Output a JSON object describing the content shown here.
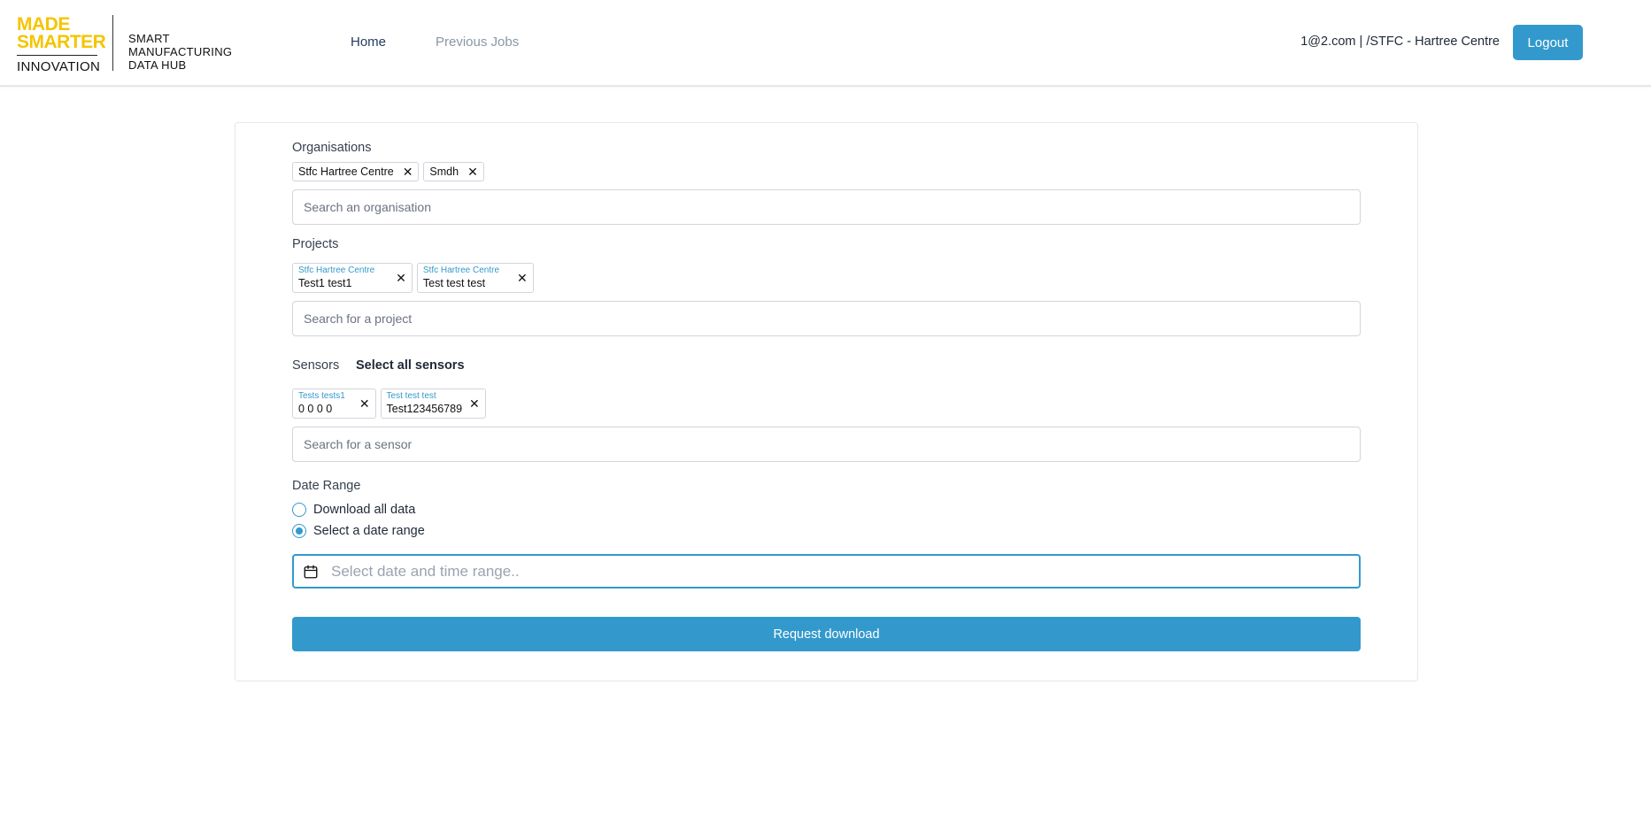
{
  "logo": {
    "line1": "MADE",
    "line2": "SMARTER",
    "line3": "INNOVATION",
    "brand_color": "#f5c400"
  },
  "hub_title": [
    "SMART",
    "MANUFACTURING",
    "DATA HUB"
  ],
  "nav": {
    "home": "Home",
    "previous_jobs": "Previous Jobs"
  },
  "user": {
    "info": "1@2.com | /STFC - Hartree Centre",
    "logout_label": "Logout"
  },
  "form": {
    "organisations": {
      "label": "Organisations",
      "chips": [
        "Stfc Hartree Centre",
        "Smdh"
      ],
      "placeholder": "Search an organisation"
    },
    "projects": {
      "label": "Projects",
      "chips": [
        {
          "sub": "Stfc Hartree Centre",
          "main": "Test1 test1"
        },
        {
          "sub": "Stfc Hartree Centre",
          "main": "Test test test"
        }
      ],
      "placeholder": "Search for a project"
    },
    "sensors": {
      "label": "Sensors",
      "select_all": "Select all sensors",
      "chips": [
        {
          "sub": "Tests tests1",
          "main": "0 0 0 0"
        },
        {
          "sub": "Test test test",
          "main": "Test123456789"
        }
      ],
      "placeholder": "Search for a sensor"
    },
    "date_range": {
      "label": "Date Range",
      "options": [
        "Download all data",
        "Select a date range"
      ],
      "selected_index": 1,
      "placeholder": "Select date and time range.."
    },
    "request_label": "Request download"
  },
  "colors": {
    "accent": "#3399cc"
  },
  "icons": {
    "chip_remove": "close-icon",
    "date": "calendar-icon"
  }
}
